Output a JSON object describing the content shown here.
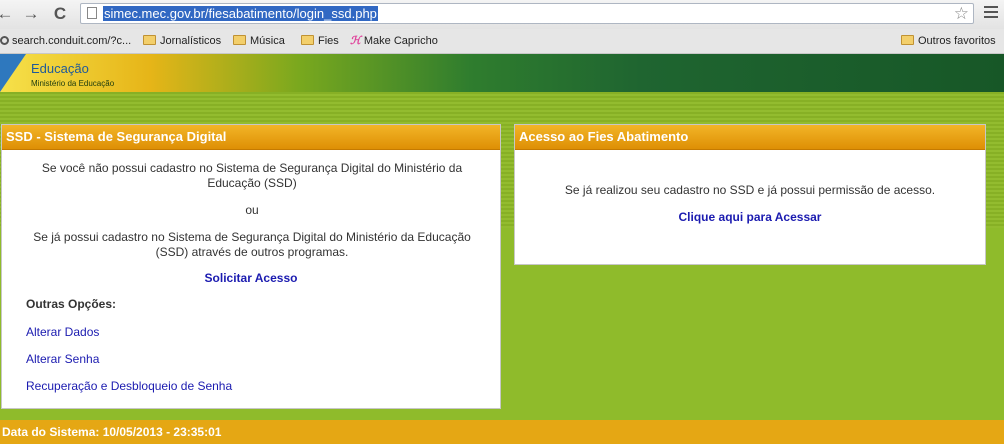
{
  "browser": {
    "back_icon": "←",
    "forward_icon": "→",
    "reload_icon": "C",
    "url": "simec.mec.gov.br/fiesabatimento/login_ssd.php",
    "star_icon": "☆"
  },
  "bookmarks": {
    "items": [
      {
        "label": "search.conduit.com/?c...",
        "icon": "search-icon"
      },
      {
        "label": "Jornalísticos",
        "icon": "folder-icon"
      },
      {
        "label": "Música",
        "icon": "folder-icon"
      },
      {
        "label": "Fies",
        "icon": "folder-icon"
      },
      {
        "label": "Make Capricho",
        "icon": "capricho-icon"
      }
    ],
    "other": "Outros favoritos"
  },
  "header": {
    "title": "Educação",
    "subtitle": "Ministério da Educação"
  },
  "ssd_panel": {
    "title": "SSD - Sistema de Segurança Digital",
    "text1": "Se você não possui cadastro no Sistema de Segurança Digital do Ministério da Educação (SSD)",
    "or": "ou",
    "text2": "Se já possui cadastro no Sistema de Segurança Digital do Ministério da Educação (SSD) através de outros programas.",
    "request_link": "Solicitar Acesso",
    "options_label": "Outras Opções:",
    "options": [
      "Alterar Dados",
      "Alterar Senha",
      "Recuperação e Desbloqueio de Senha"
    ]
  },
  "fies_panel": {
    "title": "Acesso ao Fies Abatimento",
    "text": "Se já realizou seu cadastro no SSD e já possui permissão de acesso.",
    "access_link": "Clique aqui para Acessar"
  },
  "footer": {
    "text": "Data do Sistema: 10/05/2013 - 23:35:01"
  },
  "colors": {
    "header_orange": "#e5a714",
    "page_green": "#8cb52a",
    "link_blue": "#1b1bb0"
  }
}
